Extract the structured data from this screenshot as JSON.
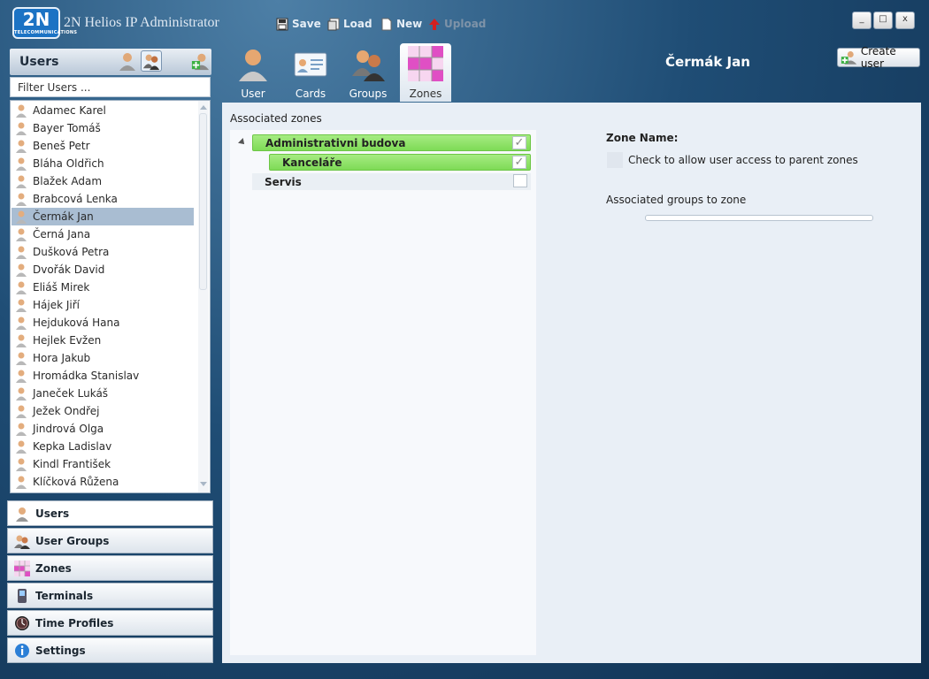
{
  "app": {
    "logo_text": "2N",
    "logo_subtext": "TELECOMMUNICATIONS",
    "title": "2N Helios IP Administrator"
  },
  "toolbar": {
    "save_label": "Save",
    "load_label": "Load",
    "new_label": "New",
    "upload_label": "Upload"
  },
  "window_controls": {
    "minimize": "_",
    "maximize": "□",
    "close": "x"
  },
  "users_panel": {
    "title": "Users",
    "filter_placeholder": "Filter Users ...",
    "selected_user": "Čermák Jan",
    "users": [
      "Adamec Karel",
      "Bayer Tomáš",
      "Beneš Petr",
      "Bláha Oldřich",
      "Blažek Adam",
      "Brabcová Lenka",
      "Čermák Jan",
      "Černá Jana",
      "Dušková Petra",
      "Dvořák David",
      "Eliáš Mirek",
      "Hájek Jiří",
      "Hejduková Hana",
      "Hejlek Evžen",
      "Hora Jakub",
      "Hromádka Stanislav",
      "Janeček Lukáš",
      "Ježek Ondřej",
      "Jindrová Olga",
      "Kepka Ladislav",
      "Kindl František",
      "Klíčková Růžena"
    ]
  },
  "nav": [
    {
      "label": "Users",
      "icon": "user-icon",
      "active": true
    },
    {
      "label": "User Groups",
      "icon": "user-groups-icon",
      "active": false
    },
    {
      "label": "Zones",
      "icon": "zones-icon",
      "active": false
    },
    {
      "label": "Terminals",
      "icon": "terminal-icon",
      "active": false
    },
    {
      "label": "Time Profiles",
      "icon": "clock-icon",
      "active": false
    },
    {
      "label": "Settings",
      "icon": "info-icon",
      "active": false
    }
  ],
  "tabs": [
    {
      "label": "User",
      "icon": "user-icon",
      "active": false
    },
    {
      "label": "Cards",
      "icon": "card-icon",
      "active": false
    },
    {
      "label": "Groups",
      "icon": "groups-icon",
      "active": false
    },
    {
      "label": "Zones",
      "icon": "zones-icon",
      "active": true
    }
  ],
  "header": {
    "user_name": "Čermák Jan",
    "create_user_label": "Create user"
  },
  "zones_view": {
    "associated_zones_label": "Associated zones",
    "zones": [
      {
        "label": "Administrativni budova",
        "checked": true,
        "highlighted": true,
        "level": 0
      },
      {
        "label": "Kanceláře",
        "checked": true,
        "highlighted": true,
        "level": 1
      },
      {
        "label": "Servis",
        "checked": false,
        "highlighted": false,
        "level": 0
      }
    ],
    "zone_name_label": "Zone Name:",
    "parent_access_label": "Check to allow user access to parent zones",
    "associated_groups_label": "Associated groups to zone"
  },
  "colors": {
    "zone_highlight": "#8ee064",
    "selected_row": "#a9bdd2",
    "background": "#1f4d75"
  }
}
